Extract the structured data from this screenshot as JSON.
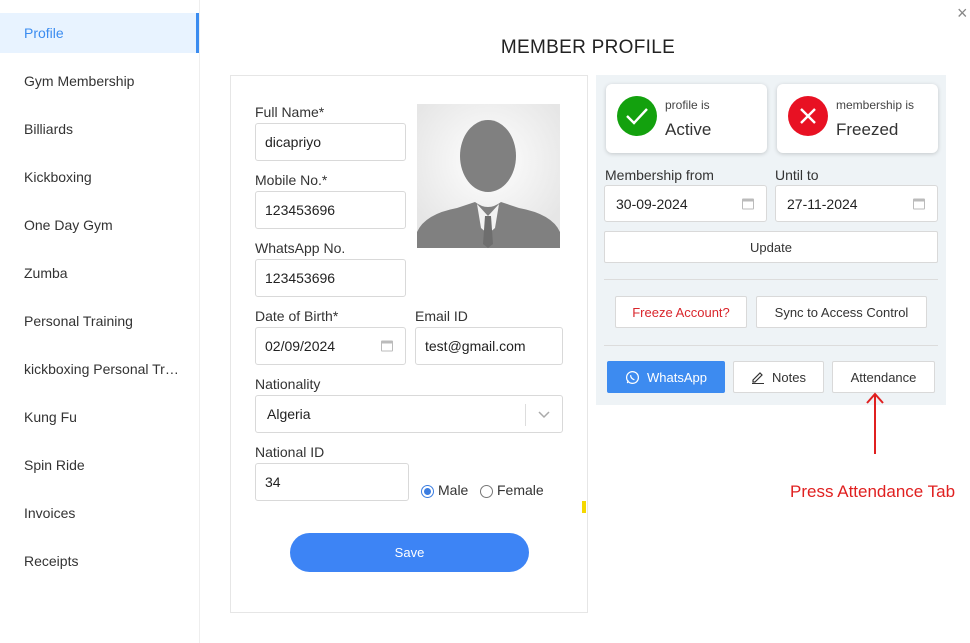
{
  "sidebar": {
    "items": [
      {
        "label": "Profile"
      },
      {
        "label": "Gym Membership"
      },
      {
        "label": "Billiards"
      },
      {
        "label": "Kickboxing"
      },
      {
        "label": "One Day Gym"
      },
      {
        "label": "Zumba"
      },
      {
        "label": "Personal Training"
      },
      {
        "label": "kickboxing Personal Trai..."
      },
      {
        "label": "Kung Fu"
      },
      {
        "label": "Spin Ride"
      },
      {
        "label": "Invoices"
      },
      {
        "label": "Receipts"
      }
    ],
    "active_index": 0
  },
  "close_label": "×",
  "page_title": "MEMBER PROFILE",
  "form": {
    "full_name_label": "Full Name*",
    "full_name_value": "dicapriyo",
    "mobile_label": "Mobile No.*",
    "mobile_value": "123453696",
    "whatsapp_label": "WhatsApp No.",
    "whatsapp_value": "123453696",
    "dob_label": "Date of Birth*",
    "dob_value": "02/09/2024",
    "email_label": "Email ID",
    "email_value": "test@gmail.com",
    "nationality_label": "Nationality",
    "nationality_value": "Algeria",
    "national_id_label": "National ID",
    "national_id_value": "34",
    "gender_male": "Male",
    "gender_female": "Female",
    "gender_selected": "Male",
    "save_label": "Save"
  },
  "status": {
    "profile_small": "profile is",
    "profile_big": "Active",
    "profile_color": "#13a10e",
    "membership_small": "membership is",
    "membership_big": "Freezed",
    "membership_color": "#e81123"
  },
  "membership": {
    "from_label": "Membership from",
    "from_value": "30-09-2024",
    "until_label": "Until to",
    "until_value": "27-11-2024",
    "update_label": "Update"
  },
  "actions": {
    "freeze_label": "Freeze Account?",
    "sync_label": "Sync to Access Control",
    "whatsapp_label": "WhatsApp",
    "notes_label": "Notes",
    "attendance_label": "Attendance"
  },
  "annotation": {
    "text": "Press Attendance Tab",
    "color": "#e02020"
  },
  "colors": {
    "accent": "#3d84f5",
    "whatsapp_button": "#3d8bf0"
  }
}
